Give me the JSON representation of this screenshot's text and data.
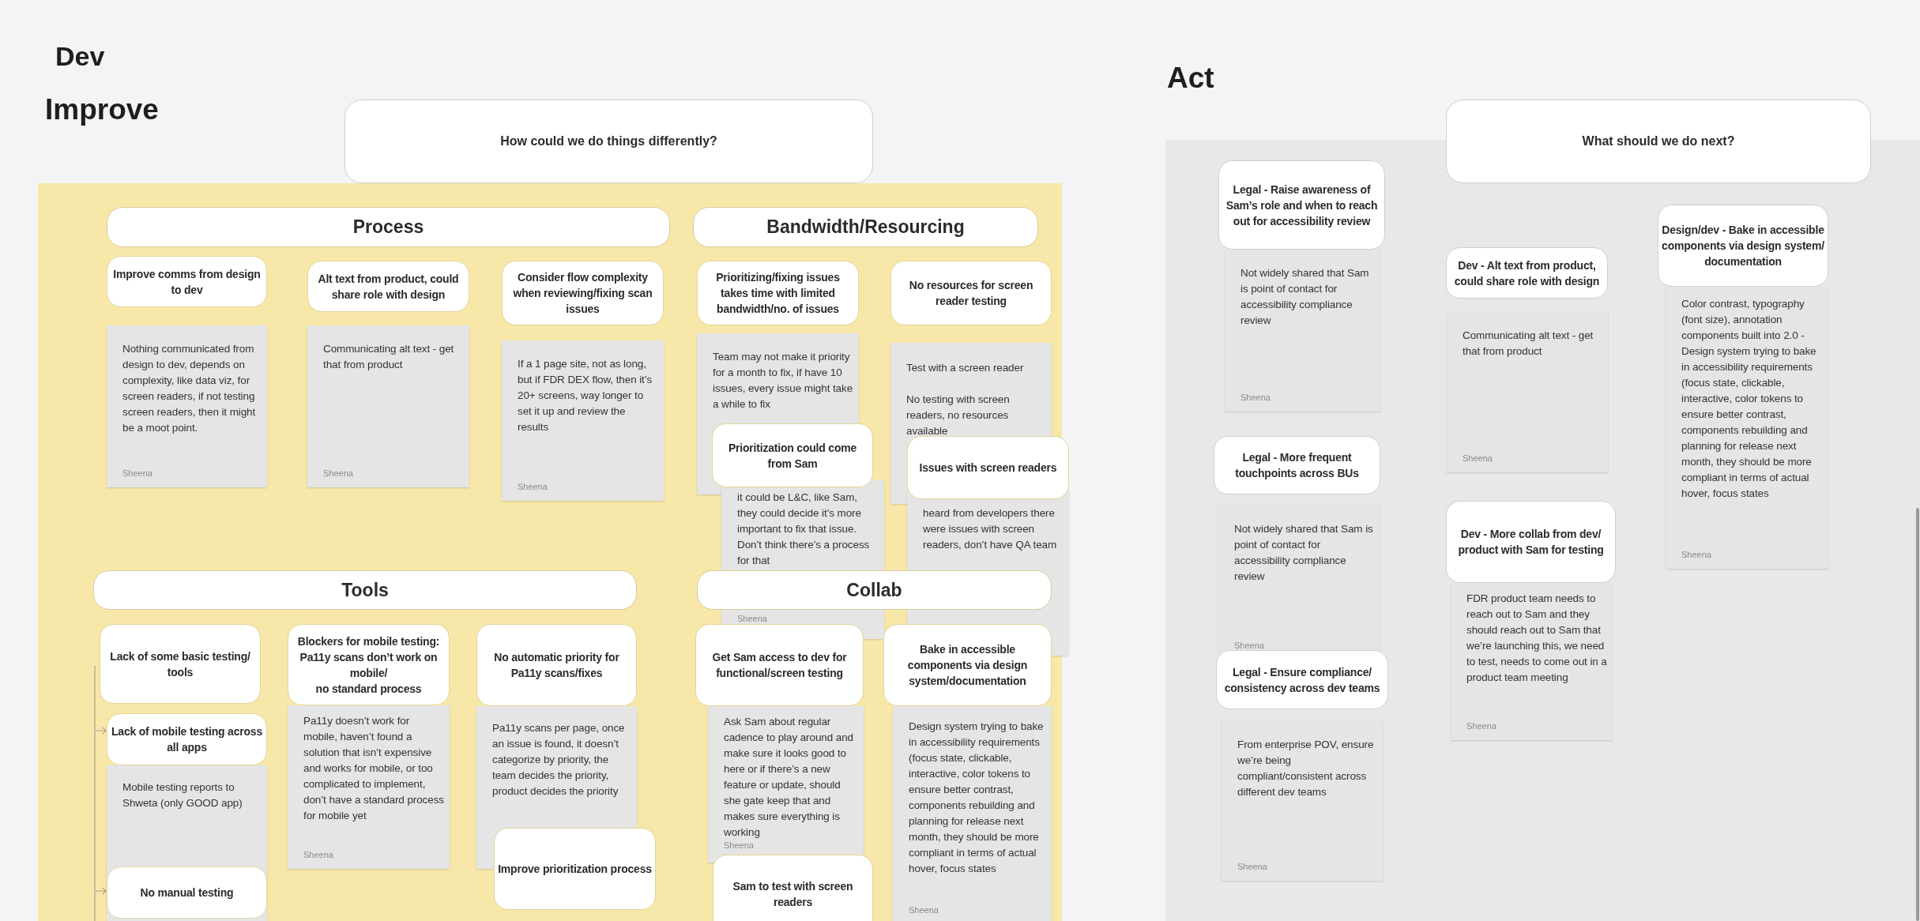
{
  "board": {
    "title": "Dev"
  },
  "sections": [
    {
      "title": "Improve",
      "question": "How could we do things differently?",
      "groups": [
        {
          "title": "Process",
          "cards": [
            {
              "title": "Improve comms from design to dev",
              "note": {
                "text": "Nothing communicated from design to dev, depends on complexity, like data viz, for screen readers, if not testing screen readers, then it might be a moot point.",
                "author": "Sheena"
              }
            },
            {
              "title": "Alt text from product, could share role with design",
              "note": {
                "text": "Communicating alt text - get that from product",
                "author": "Sheena"
              }
            },
            {
              "title": "Consider flow complexity when reviewing/fixing scan issues",
              "note": {
                "text": "If a 1 page site, not as long, but if FDR DEX flow, then it’s 20+ screens, way longer to set it up and review the results",
                "author": "Sheena"
              }
            }
          ]
        },
        {
          "title": "Bandwidth/Resourcing",
          "cards": [
            {
              "title": "Prioritizing/fixing issues takes time with limited bandwidth/no. of issues",
              "note": {
                "text": "Team may not make it priority for a month to fix, if have 10 issues, every issue might take a while to fix"
              }
            },
            {
              "title": "No resources for screen reader testing",
              "note": {
                "text": "Test with a screen reader\n\nNo testing with screen readers, no resources available"
              }
            },
            {
              "title": "Prioritization could come from Sam",
              "note": {
                "text": "it could be L&C, like Sam, they could decide it’s more important to fix that issue. Don’t think there’s a process for that",
                "author": "Sheena"
              }
            },
            {
              "title": "Issues with screen readers",
              "note": {
                "text": "heard from developers there were issues with screen readers, don’t have QA team"
              }
            }
          ]
        },
        {
          "title": "Tools",
          "cards": [
            {
              "title": "Lack of some basic testing/ tools"
            },
            {
              "title": "Lack of mobile testing across all apps",
              "note": {
                "text": "Mobile testing reports to Shweta (only GOOD app)"
              }
            },
            {
              "title": "No manual testing"
            },
            {
              "title": "Blockers for mobile testing: Pa11y scans don’t work on mobile/\nno standard process",
              "note": {
                "text": "Pa11y doesn’t work for mobile, haven’t found a solution that isn’t expensive and works for mobile, or too complicated to implement, don’t have a standard process for mobile yet",
                "author": "Sheena"
              }
            },
            {
              "title": "No automatic priority for Pa11y scans/fixes",
              "note": {
                "text": "Pa11y scans per page, once an issue is found, it doesn’t categorize by priority, the team decides the priority, product decides the priority"
              }
            },
            {
              "title": "Improve prioritization process"
            }
          ]
        },
        {
          "title": "Collab",
          "cards": [
            {
              "title": "Get Sam access to dev for functional/screen testing",
              "note": {
                "text": "Ask Sam about regular cadence to play around and make sure it looks good to here or if there’s a new feature or update, should she gate keep that and makes sure everything is working",
                "author": "Sheena"
              }
            },
            {
              "title": "Sam to test with screen readers"
            },
            {
              "title": "Bake in accessible components via design system/documentation",
              "note": {
                "text": "Design system trying to bake in accessibility requirements (focus state, clickable, interactive, color tokens to ensure better contrast, components rebuilding and planning for release next month, they should be more compliant in terms of actual hover, focus states",
                "author": "Sheena"
              }
            }
          ]
        }
      ]
    },
    {
      "title": "Act",
      "question": "What should we do next?",
      "cards": [
        {
          "title": "Legal - Raise awareness of Sam’s role and when to reach out for accessibility review",
          "note": {
            "text": "Not widely shared that Sam is point of contact for accessibility compliance review",
            "author": "Sheena"
          }
        },
        {
          "title": "Legal - More frequent touchpoints across BUs",
          "note": {
            "text": "Not widely shared that Sam is point of contact for accessibility compliance review",
            "author": "Sheena"
          }
        },
        {
          "title": "Legal - Ensure compliance/ consistency across dev teams",
          "note": {
            "text": "From enterprise POV, ensure we’re being compliant/consistent across different dev teams",
            "author": "Sheena"
          }
        },
        {
          "title": "Dev - Alt text from product, could share role with design",
          "note": {
            "text": "Communicating alt text - get that from product",
            "author": "Sheena"
          }
        },
        {
          "title": "Dev - More collab from dev/ product with Sam for testing",
          "note": {
            "text": "FDR product team needs to reach out to Sam and they should reach out to Sam that we’re launching this, we need to test, needs to come out in a product team meeting",
            "author": "Sheena"
          }
        },
        {
          "title": "Design/dev - Bake in accessible components via design system/ documentation",
          "note": {
            "text": "Color contrast, typography (font size), annotation components built into 2.0 - Design system trying to bake in accessibility requirements (focus state, clickable, interactive, color tokens to ensure better contrast, components rebuilding and planning for release next month, they should be more compliant in terms of actual hover, focus states",
            "author": "Sheena"
          }
        }
      ]
    }
  ]
}
